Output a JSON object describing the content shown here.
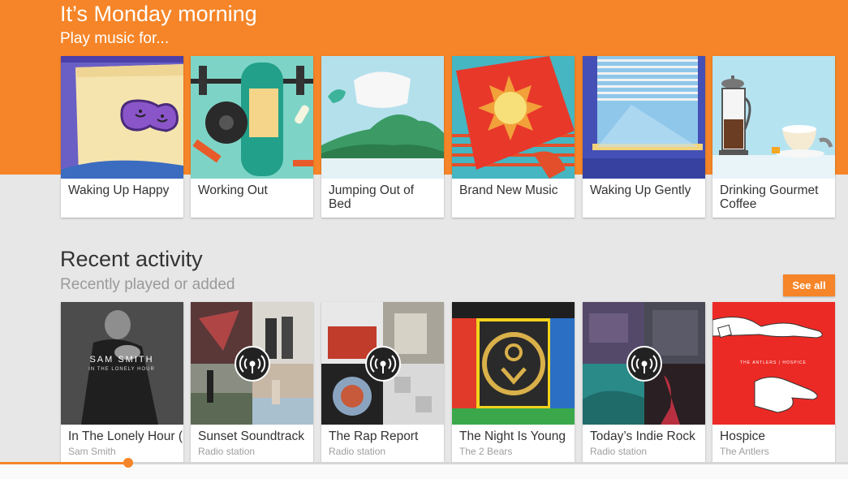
{
  "header": {
    "title": "It’s Monday morning",
    "subtitle": "Play music for..."
  },
  "moods": [
    {
      "label": "Waking Up Happy"
    },
    {
      "label": "Working Out"
    },
    {
      "label": "Jumping Out of Bed"
    },
    {
      "label": "Brand New Music"
    },
    {
      "label": "Waking Up Gently"
    },
    {
      "label": "Drinking Gourmet Coffee"
    }
  ],
  "recent": {
    "title": "Recent activity",
    "subtitle": "Recently played or added",
    "see_all_label": "See all",
    "items": [
      {
        "title": "In The Lonely Hour (",
        "subtitle": "Sam Smith",
        "art_text_1": "SAM SMITH",
        "art_text_2": "IN THE LONELY HOUR"
      },
      {
        "title": "Sunset Soundtrack",
        "subtitle": "Radio station"
      },
      {
        "title": "The Rap Report",
        "subtitle": "Radio station"
      },
      {
        "title": "The Night Is Young",
        "subtitle": "The 2 Bears"
      },
      {
        "title": "Today’s Indie Rock",
        "subtitle": "Radio station"
      },
      {
        "title": "Hospice",
        "subtitle": "The Antlers",
        "art_text": "THE ANTLERS | HOSPICE"
      }
    ]
  },
  "player": {
    "progress": 0.151,
    "accent_color": "#f58528"
  }
}
